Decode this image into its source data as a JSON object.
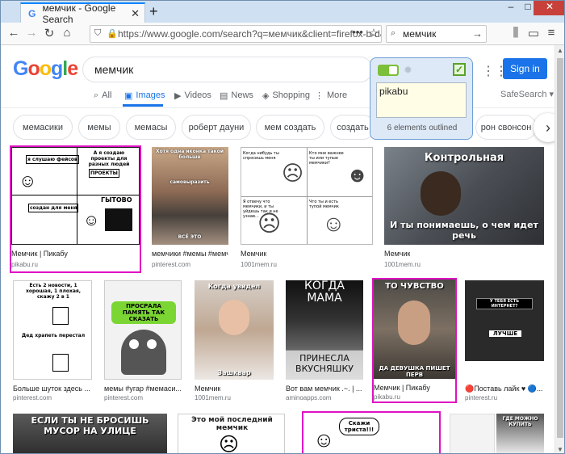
{
  "browser": {
    "tab_title": "мемчик - Google Search",
    "url": "https://www.google.com/search?q=мемчик&client=firefox-b-d&s",
    "search_value": "мемчик"
  },
  "google": {
    "logo": "Google",
    "query": "мемчик",
    "sign_in": "Sign in",
    "safesearch": "SafeSearch ▾",
    "nav": [
      {
        "label": "All",
        "icon": "search-icon"
      },
      {
        "label": "Images",
        "icon": "image-icon"
      },
      {
        "label": "Videos",
        "icon": "video-icon"
      },
      {
        "label": "News",
        "icon": "news-icon"
      },
      {
        "label": "Shopping",
        "icon": "tag-icon"
      },
      {
        "label": "More",
        "icon": "more-icon"
      }
    ],
    "chips": [
      "мемасики",
      "мемы",
      "мемасы",
      "роберт дауни",
      "мем создать",
      "создать",
      "рон свонсон"
    ]
  },
  "extension": {
    "text": "pikabu",
    "count": "6 elements outlined"
  },
  "results": [
    {
      "title": "Мемчик | Пикабу",
      "source": "pikabu.ru"
    },
    {
      "title": "мемчики #мемы #мемчик...",
      "source": "pinterest.com"
    },
    {
      "title": "Мемчик",
      "source": "1001mem.ru"
    },
    {
      "title": "Мемчик",
      "source": "1001mem.ru"
    },
    {
      "title": "Больше шуток здесь ...",
      "source": "pinterest.com"
    },
    {
      "title": "мемы #угар #мемаси...",
      "source": "pinterest.com"
    },
    {
      "title": "Мемчик",
      "source": "1001mem.ru"
    },
    {
      "title": "Вот вам мемчик .~. | ...",
      "source": "aminoapps.com"
    },
    {
      "title": "Мемчик | Пикабу",
      "source": "pikabu.ru"
    },
    {
      "title": "🔴Поставь лайк ♥ 🔵...",
      "source": "pinterest.ru"
    }
  ],
  "meme_text": {
    "r1c1": [
      "я слушаю фейсов",
      "А я создаю проекты для разных людей",
      "ПРОЕКТЫ",
      "создан для меня",
      "ГЫТОВО"
    ],
    "r1c2": [
      "Хотя одна иконка такой больше",
      "самовыразить",
      "ВСЁ ЭТО"
    ],
    "r1c3": [
      "Когда нибудь ты спросишь меня",
      "Кто мне важнее ты или тупые мемчики?",
      "Я отвечу что мемчики, и ты уйдешь так и не узнав...",
      "Что ты и есть тупой мемчик"
    ],
    "r1c4": [
      "Контрольная",
      "И ты понимаешь, о чем идет речь"
    ],
    "r2c1": [
      "Есть 2 новости, 1 хорошая, 1 плохая, скажу 2 в 1",
      "Дед храпеть перестал"
    ],
    "r2c2": [
      "ПРОСРАЛА ПАМЯТЬ ТАК СКАЗАТЬ"
    ],
    "r2c3": [
      "Когда увидел",
      "Зашквар"
    ],
    "r2c4": [
      "КОГДА МАМА",
      "ПРИНЕСЛА ВКУСНЯШКУ"
    ],
    "r2c5": [
      "ТО ЧУВСТВО",
      "ДА ДЕВУШКА ПИШЕТ ПЕРВ"
    ],
    "r2c6": [
      "У ТЕБЯ ЕСТЬ ИНТЕРНЕТ?",
      "ЛУЧШЕ"
    ],
    "r3c1": [
      "ЕСЛИ ТЫ НЕ БРОСИШЬ МУСОР НА УЛИЦЕ"
    ],
    "r3c2": [
      "Это мой последний мемчик"
    ],
    "r3c3": [
      "Скажи триста!!!"
    ],
    "r3c5": [
      "ГДЕ МОЖНО КУПИТЬ"
    ]
  },
  "colors": {
    "accent": "#1a73e8",
    "outline": "#e011c4",
    "ext_bg": "#dde9f6"
  }
}
